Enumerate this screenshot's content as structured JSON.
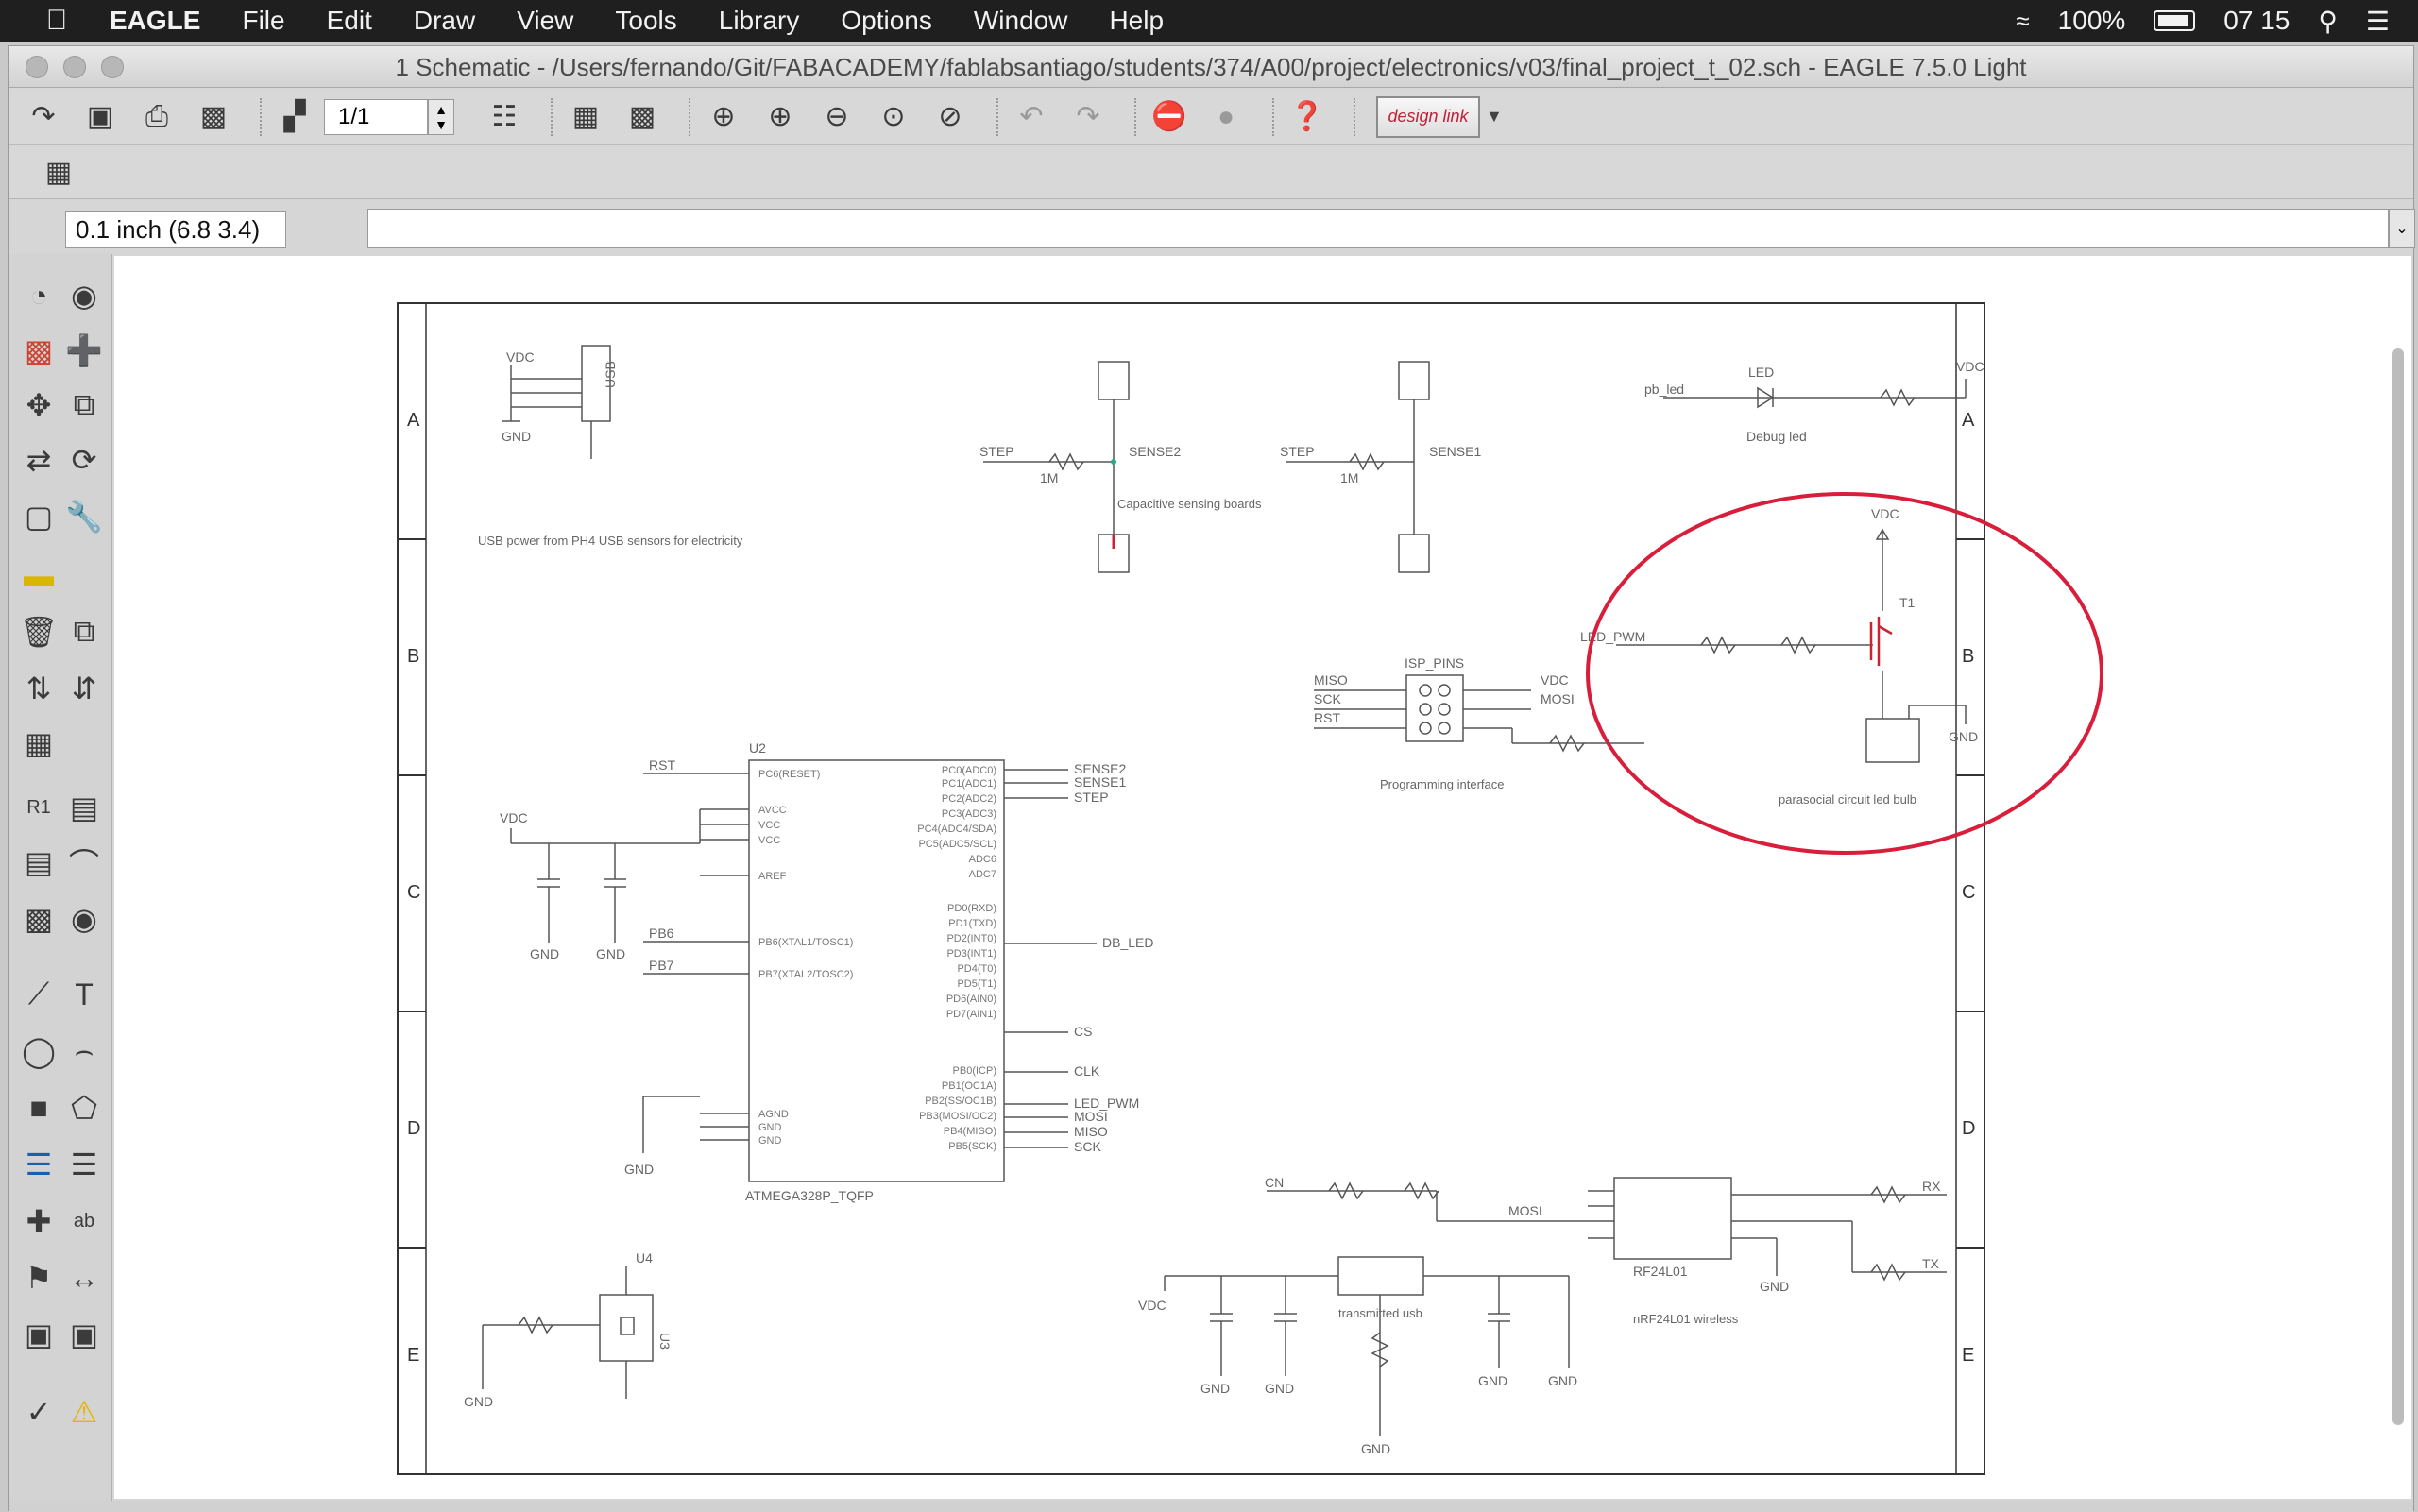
{
  "menubar": {
    "app_name": "EAGLE",
    "items": [
      "File",
      "Edit",
      "Draw",
      "View",
      "Tools",
      "Library",
      "Options",
      "Window",
      "Help"
    ],
    "battery": "100%",
    "clock": "07 15"
  },
  "window": {
    "title": "1 Schematic - /Users/fernando/Git/FABACADEMY/fablabsantiago/students/374/A00/project/electronics/v03/final_project_t_02.sch - EAGLE 7.5.0 Light"
  },
  "toolbar": {
    "sheet_value": "1/1",
    "designlink_label": "design link"
  },
  "command_bar": {
    "coordinates": "0.1 inch (6.8 3.4)",
    "command_value": ""
  },
  "schematic": {
    "frame_rows": [
      "A",
      "B",
      "C",
      "D",
      "E"
    ],
    "highlight_color": "#d81e3a",
    "labels": {
      "vdc": "VDC",
      "gnd": "GND",
      "usb": "USB",
      "usb_caption": "USB power from PH4 USB sensors for electricity",
      "sensor1": "SENSE1",
      "sensor2": "SENSE2",
      "step": "STEP",
      "r_1m": "1M",
      "cap_caption": "Capacitive sensing boards",
      "led_label": "LED",
      "led_net": "pb_led",
      "debug_led": "Debug led",
      "isp_title": "ISP_PINS",
      "isp_caption": "Programming interface",
      "mcu_name": "U2",
      "mcu_part": "ATMEGA328P_TQFP",
      "rst": "RST",
      "pb6": "PB6",
      "pb7": "PB7",
      "aref": "AREF",
      "db_led": "DB_LED",
      "cs": "CS",
      "clk": "CLK",
      "led_pwm": "LED_PWM",
      "miso": "MISO",
      "mosi": "MOSI",
      "sck": "SCK",
      "led_pwm_net": "LED_PWM",
      "mosfet_t1": "T1",
      "mosfet_caption": "parasocial circuit led bulb",
      "regulator_caption": "transmitted usb",
      "nrf_caption": "nRF24L01 wireless",
      "nrf_part": "RF24L01",
      "mosi_net": "MOSI",
      "rx": "RX",
      "tx": "TX",
      "cn": "CN",
      "u3": "U3",
      "u4": "U4",
      "mcu_pins_left": [
        "PC6(RESET)",
        "AVCC",
        "VCC",
        "VCC",
        "AREF",
        "PB6(XTAL1/TOSC1)",
        "PB7(XTAL2/TOSC2)",
        "AGND",
        "GND",
        "GND"
      ],
      "mcu_pins_right": [
        "PC0(ADC0)",
        "PC1(ADC1)",
        "PC2(ADC2)",
        "PC3(ADC3)",
        "PC4(ADC4/SDA)",
        "PC5(ADC5/SCL)",
        "ADC6",
        "ADC7",
        "PD0(RXD)",
        "PD1(TXD)",
        "PD2(INT0)",
        "PD3(INT1)",
        "PD4(T0)",
        "PD5(T1)",
        "PD6(AIN0)",
        "PD7(AIN1)",
        "PB0(ICP)",
        "PB1(OC1A)",
        "PB2(SS/OC1B)",
        "PB3(MOSI/OC2)",
        "PB4(MISO)",
        "PB5(SCK)"
      ]
    }
  }
}
